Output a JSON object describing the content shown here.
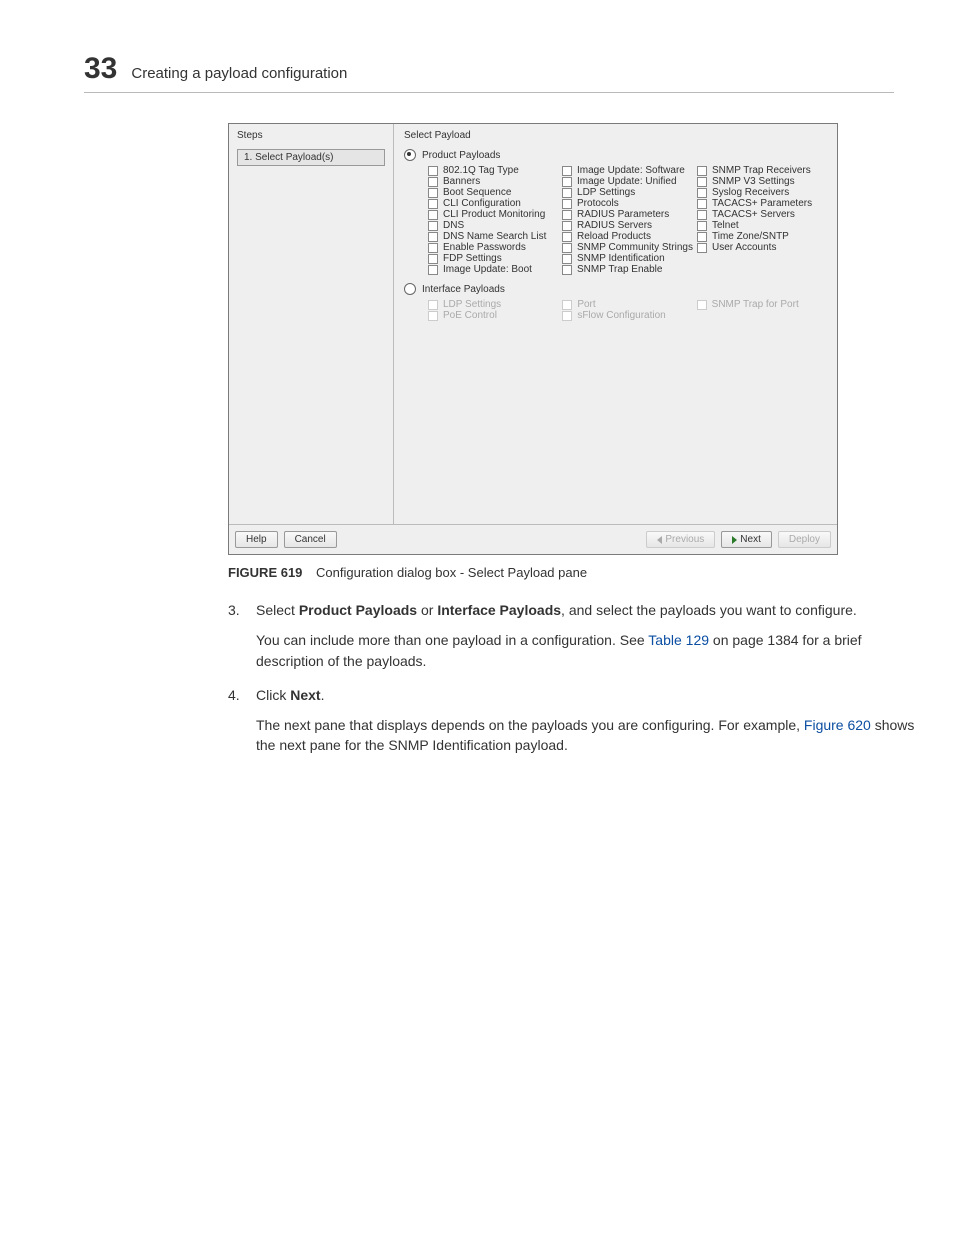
{
  "header": {
    "chapter_number": "33",
    "chapter_title": "Creating a payload configuration"
  },
  "dialog": {
    "steps_label": "Steps",
    "step_item": "1. Select Payload(s)",
    "panel_title": "Select Payload",
    "product_radio": "Product Payloads",
    "interface_radio": "Interface Payloads",
    "product_cols": {
      "c1": [
        "802.1Q Tag Type",
        "Banners",
        "Boot Sequence",
        "CLI Configuration",
        "CLI Product Monitoring",
        "DNS",
        "DNS Name Search List",
        "Enable Passwords",
        "FDP Settings",
        "Image Update: Boot"
      ],
      "c2": [
        "Image Update: Software",
        "Image Update: Unified",
        "LDP Settings",
        "Protocols",
        "RADIUS Parameters",
        "RADIUS Servers",
        "Reload Products",
        "SNMP Community Strings",
        "SNMP Identification",
        "SNMP Trap Enable"
      ],
      "c3": [
        "SNMP Trap Receivers",
        "SNMP V3 Settings",
        "Syslog Receivers",
        "TACACS+ Parameters",
        "TACACS+ Servers",
        "Telnet",
        "Time Zone/SNTP",
        "User Accounts"
      ]
    },
    "interface_cols": {
      "c1": [
        "LDP Settings",
        "PoE Control"
      ],
      "c2": [
        "Port",
        "sFlow Configuration"
      ],
      "c3": [
        "SNMP Trap for Port"
      ]
    },
    "buttons": {
      "help": "Help",
      "cancel": "Cancel",
      "previous": "Previous",
      "next": "Next",
      "deploy": "Deploy"
    }
  },
  "caption": {
    "figure_label": "FIGURE 619",
    "figure_text": "Configuration dialog box - Select Payload pane"
  },
  "body": {
    "step3_num": "3.",
    "step3_pre": "Select ",
    "step3_b1": "Product Payloads",
    "step3_mid": " or ",
    "step3_b2": "Interface Payloads",
    "step3_post": ", and select the payloads you want to configure.",
    "step3_sub_pre": "You can include more than one payload in a configuration. See ",
    "step3_link": "Table 129",
    "step3_sub_post": " on page 1384 for a brief description of the payloads.",
    "step4_num": "4.",
    "step4_pre": "Click ",
    "step4_b": "Next",
    "step4_post": ".",
    "step4_sub_pre": "The next pane that displays depends on the payloads you are configuring. For example, ",
    "step4_link": "Figure 620",
    "step4_sub_post": " shows the next pane for the SNMP Identification payload."
  }
}
